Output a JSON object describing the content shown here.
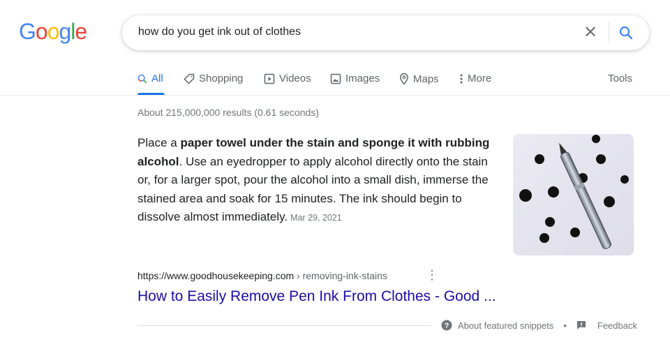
{
  "logo": {
    "text": "Google",
    "colors": [
      "#4285F4",
      "#EA4335",
      "#FBBC05",
      "#4285F4",
      "#34A853",
      "#EA4335"
    ]
  },
  "search": {
    "query": "how do you get ink out of clothes",
    "clear_icon": "close-icon",
    "search_icon": "search-icon"
  },
  "tabs": [
    {
      "label": "All",
      "icon": "search-icon",
      "active": true
    },
    {
      "label": "Shopping",
      "icon": "tag-icon"
    },
    {
      "label": "Videos",
      "icon": "play-icon"
    },
    {
      "label": "Images",
      "icon": "image-icon"
    },
    {
      "label": "Maps",
      "icon": "map-pin-icon"
    },
    {
      "label": "More",
      "icon": "more-vert-icon"
    }
  ],
  "tools_label": "Tools",
  "stats": "About 215,000,000 results (0.61 seconds)",
  "snippet": {
    "lead": "Place a ",
    "bold": "paper towel under the stain and sponge it with rubbing alcohol",
    "rest": ". Use an eyedropper to apply alcohol directly onto the stain or, for a larger spot, pour the alcohol into a small dish, immerse the stained area and soak for 15 minutes. The ink should begin to dissolve almost immediately.",
    "date": "Mar 29, 2021"
  },
  "result": {
    "url_domain": "https://www.goodhousekeeping.com",
    "url_path": " › removing-ink-stains",
    "title": "How to Easily Remove Pen Ink From Clothes - Good ..."
  },
  "footer": {
    "about": "About featured snippets",
    "separator": "•",
    "feedback": "Feedback"
  },
  "accent_color": "#1a73e8",
  "link_color": "#1a0dab"
}
